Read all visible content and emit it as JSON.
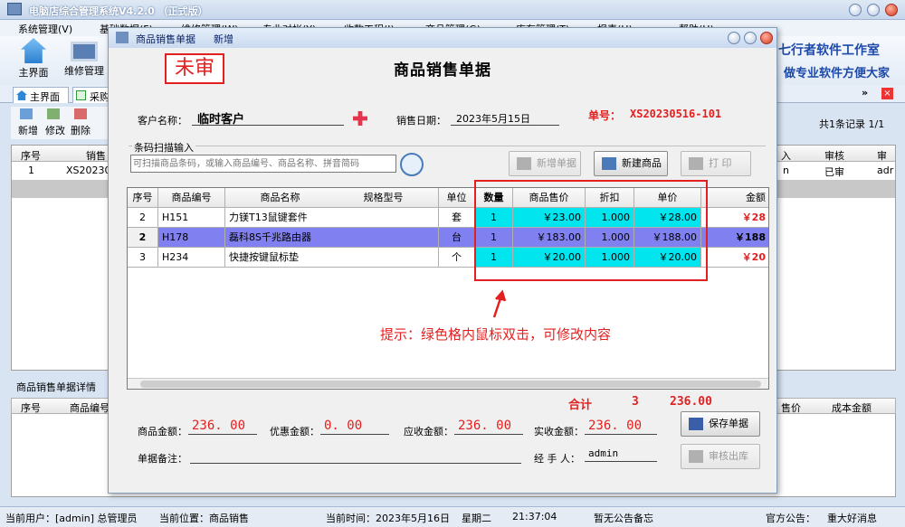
{
  "main": {
    "title": "电脑店综合管理系统V4.2.0 （正式版）",
    "menu": [
      "系统管理(V)",
      "基础数据(F)",
      "维修管理(W)",
      "专业对帐(Y)",
      "收款工程(J)",
      "商品管理(G)",
      "库存管理(T)",
      "报表(H)",
      "帮助(H)"
    ],
    "toolbar": {
      "home": "主界面",
      "repair": "维修管理"
    },
    "brand_line1": "七行者软件工作室",
    "brand_line2": "做专业软件方便大家",
    "tabs": [
      "主界面",
      "采购"
    ],
    "list_toolbar": {
      "add": "新增",
      "edit": "修改",
      "delete": "删除"
    },
    "record_info": "共1条记录 1/1",
    "list_columns": [
      "序号",
      "销售",
      "入",
      "审核",
      "审核"
    ],
    "list_row": {
      "no": "1",
      "code": "XS20230",
      "person": "n",
      "status": "已审",
      "auditor": "adr"
    },
    "detail_label": "商品销售单据详情",
    "detail_columns": [
      "序号",
      "商品编号",
      "售价",
      "成本金额"
    ]
  },
  "status": {
    "user": "当前用户：[admin] 总管理员",
    "location": "当前位置：商品销售",
    "time_label": "当前时间：2023年5月16日",
    "weekday": "星期二",
    "clock": "21:37:04",
    "notice": "暂无公告备忘",
    "official": "官方公告：",
    "message": "重大好消息"
  },
  "dialog": {
    "title_left": "商品销售单据",
    "title_right": "新增",
    "stamp": "未审",
    "heading": "商品销售单据",
    "customer_label": "客户名称：",
    "customer_value": "临时客户",
    "date_label": "销售日期：",
    "date_value": "2023年5月15日",
    "order_label": "单号：",
    "order_value": "XS20230516-101",
    "scan_label": "条码扫描输入",
    "scan_placeholder": "可扫描商品条码，或输入商品编号、商品名称、拼音简码",
    "btn_new_bill": "新增单据",
    "btn_new_goods": "新建商品",
    "btn_print": "打 印",
    "columns": [
      "序号",
      "商品编号",
      "商品名称",
      "规格型号",
      "单位",
      "数量",
      "商品售价",
      "折扣",
      "单价",
      "金额"
    ],
    "rows": [
      {
        "no": "2",
        "code": "H151",
        "name": "力镁T13鼠键套件",
        "spec": "",
        "unit": "套",
        "qty": "1",
        "price": "￥23.00",
        "discount": "1.000",
        "unit_price": "￥28.00",
        "amount": "￥28"
      },
      {
        "no": "2",
        "code": "H178",
        "name": "磊科8S千兆路由器",
        "spec": "",
        "unit": "台",
        "qty": "1",
        "price": "￥183.00",
        "discount": "1.000",
        "unit_price": "￥188.00",
        "amount": "￥188"
      },
      {
        "no": "3",
        "code": "H234",
        "name": "快捷按键鼠标垫",
        "spec": "",
        "unit": "个",
        "qty": "1",
        "price": "￥20.00",
        "discount": "1.000",
        "unit_price": "￥20.00",
        "amount": "￥20"
      }
    ],
    "hint": "提示：绿色格内鼠标双击，可修改内容",
    "total_label": "合计",
    "total_qty": "3",
    "total_amount": "236.00",
    "goods_amount_label": "商品金额：",
    "goods_amount": "236. 00",
    "discount_label": "优惠金额：",
    "discount_amount": "0. 00",
    "receivable_label": "应收金额：",
    "receivable": "236. 00",
    "received_label": "实收金额：",
    "received": "236. 00",
    "btn_save": "保存单据",
    "remark_label": "单据备注：",
    "handler_label": "经 手 人：",
    "handler": "admin",
    "btn_audit": "审核出库"
  }
}
